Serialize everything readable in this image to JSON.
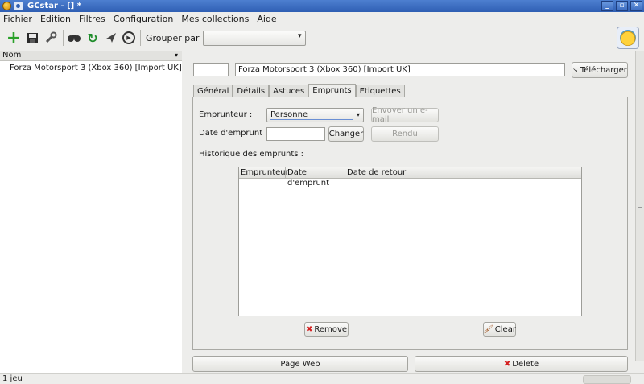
{
  "window": {
    "title": "GCstar - [] *"
  },
  "menu": [
    "Fichier",
    "Edition",
    "Filtres",
    "Configuration",
    "Mes collections",
    "Aide"
  ],
  "toolbar": {
    "group_label": "Grouper par",
    "group_value": ""
  },
  "list": {
    "column_header": "Nom",
    "items": [
      "Forza Motorsport 3 (Xbox 360) [Import UK]"
    ]
  },
  "item": {
    "id": "",
    "title": "Forza Motorsport 3 (Xbox 360) [Import UK]",
    "download_label": "Télécharger"
  },
  "tabs": [
    "Général",
    "Détails",
    "Astuces",
    "Emprunts",
    "Etiquettes"
  ],
  "loans": {
    "borrower_label": "Emprunteur :",
    "borrower_value": "Personne",
    "email_button": "Envoyer un e-mail",
    "date_label": "Date d'emprunt :",
    "date_value": "",
    "change_button": "Changer",
    "returned_button": "Rendu",
    "history_label": "Historique des emprunts :",
    "history_columns": [
      "Emprunteur",
      "Date d'emprunt",
      "Date de retour"
    ],
    "remove_button": "Remove",
    "clear_button": "Clear"
  },
  "bottom": {
    "web_button": "Page Web",
    "delete_button": "Delete"
  },
  "status": {
    "text": "1 jeu"
  },
  "colors": {
    "titlebar": "#2f5fb3",
    "background": "#ededeb",
    "delete_icon": "#d42020"
  }
}
